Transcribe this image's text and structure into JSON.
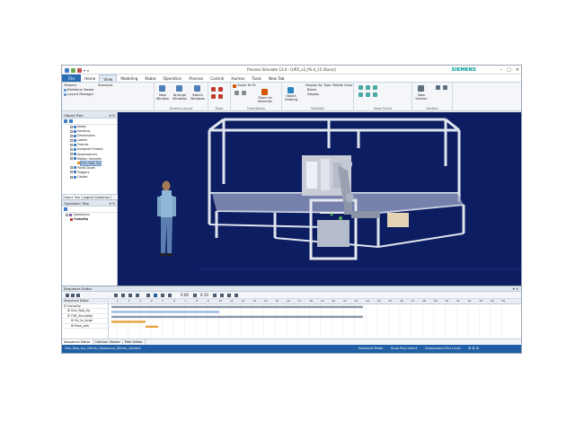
{
  "window": {
    "title": "Process Simulate 13.0 - [UR5_v2_PS-4_15 (Runs)]",
    "brand": "SIEMENS",
    "quick_access": "▾ ≡",
    "controls": [
      "–",
      "□",
      "✕"
    ]
  },
  "menu": {
    "tabs": [
      "File",
      "Home",
      "View",
      "Modeling",
      "Robot",
      "Operation",
      "Process",
      "Control",
      "Human",
      "Tools",
      "New Tab"
    ],
    "selected": "View"
  },
  "ribbon": {
    "viewers": {
      "label": "Viewers",
      "standard": "Standard",
      "items": [
        "Relations Viewer",
        "Layout Manager"
      ]
    },
    "screen_layout": {
      "label": "Screen Layout",
      "buttons": [
        "New Window",
        "Arrange Windows",
        "Switch Windows"
      ]
    },
    "style": {
      "label": "Style"
    },
    "orientation": {
      "label": "Orientation",
      "zoom_to_fit": "Zoom To Fit",
      "zoom_to_selection": "Zoom to Selection"
    },
    "visibility": {
      "label": "Visibility",
      "object_viewing": "Object Viewing",
      "display_by_type": "Display By Type",
      "modify_color": "Modify Color",
      "blank": "Blank",
      "display": "Display"
    },
    "view_points": {
      "label": "View Points"
    },
    "section": {
      "label": "Section",
      "new_section": "New Section"
    }
  },
  "object_tree": {
    "title": "Object Tree",
    "items": [
      "Notes",
      "Sections",
      "Dimensions",
      "Labels",
      "Frames",
      "Assigned Prototp",
      "Appearances",
      "Motion Volumes",
      "Gen_Rob_Op",
      "PointClouds",
      "Triggers",
      "Cables"
    ],
    "highlighted_item": "Gen_Rob_Op",
    "tabs": [
      "Object Tree",
      "Logical Collection"
    ]
  },
  "operation_tree": {
    "title": "Operation Tree",
    "items": [
      "Operations",
      "CompOp"
    ]
  },
  "sequence_editor": {
    "title": "Sequence Editor",
    "time_1": "0.00",
    "time_2": "0.10",
    "rows": [
      "Sequence Editor",
      "CompOp",
      "Gen_Rob_Op",
      "TSB_Simulator",
      "Go_to_large",
      "Pose_pick"
    ],
    "ticks": [
      "1",
      "2",
      "3",
      "4",
      "5",
      "6",
      "7",
      "8",
      "9",
      "10",
      "11",
      "12",
      "13",
      "14",
      "15",
      "16",
      "17",
      "18",
      "19",
      "20",
      "21",
      "22",
      "23",
      "24",
      "25",
      "26",
      "27",
      "28",
      "29",
      "30",
      "31",
      "32",
      "33",
      "34",
      "35"
    ],
    "tabs": [
      "Sequence Editor",
      "Collision Viewer",
      "Path Editor"
    ]
  },
  "status_bar": {
    "left": "Gen_Rob_Op_25mm_Clearance_85mm_Volume",
    "mode": "Standard Mode",
    "snap": "Snap Pick Intent",
    "level": "Component Pick Level",
    "extra": "⚙ ⚙ ⚙"
  },
  "colors": {
    "viewport_bg": "#0c1d62",
    "accent": "#2b6cb0",
    "brand": "#009999",
    "bar_gray": "#8a97a8",
    "bar_orange": "#e6a23c"
  }
}
